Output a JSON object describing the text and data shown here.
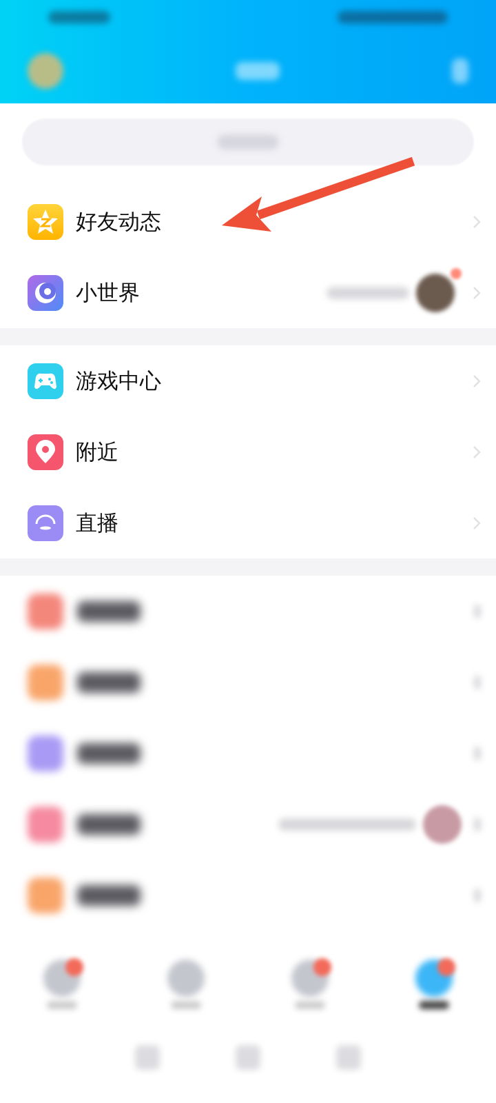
{
  "sections": [
    {
      "items": [
        {
          "label": "好友动态",
          "kind": "star",
          "preview": false
        },
        {
          "label": "小世界",
          "kind": "planet",
          "preview": true
        }
      ]
    },
    {
      "items": [
        {
          "label": "游戏中心",
          "kind": "gamepad",
          "preview": false
        },
        {
          "label": "附近",
          "kind": "pin",
          "preview": false
        },
        {
          "label": "直播",
          "kind": "live",
          "preview": false
        }
      ]
    }
  ],
  "blurred_rows": [
    {
      "color": "#f4877c",
      "preview": false
    },
    {
      "color": "#f9a56a",
      "preview": false
    },
    {
      "color": "#a99af5",
      "preview": false
    },
    {
      "color": "#f58aa0",
      "preview": true
    },
    {
      "color": "#f9a56a",
      "preview": false
    }
  ],
  "bottom_nav": [
    {
      "badge": true,
      "selected": false
    },
    {
      "badge": false,
      "selected": false
    },
    {
      "badge": true,
      "selected": false
    },
    {
      "badge": true,
      "selected": true
    }
  ]
}
